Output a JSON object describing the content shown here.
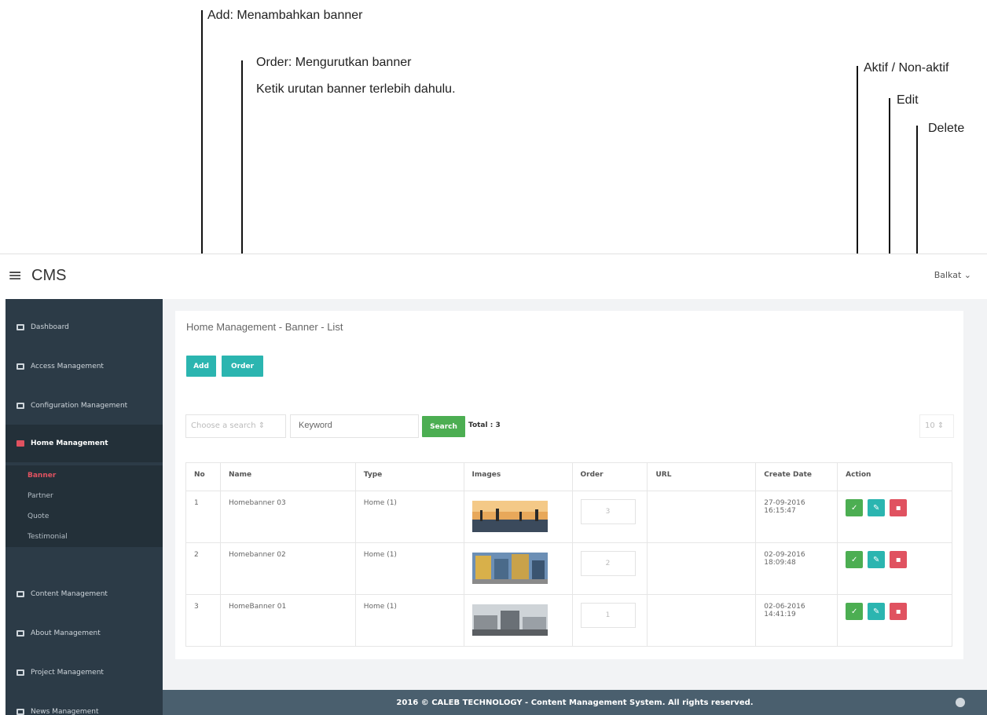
{
  "annotations": {
    "add": "Add: Menambahkan banner",
    "order_title": "Order: Mengurutkan banner",
    "order_desc": "Ketik urutan banner terlebih dahulu.",
    "aktif": "Aktif / Non-aktif",
    "edit": "Edit",
    "delete": "Delete"
  },
  "topbar": {
    "brand": "CMS",
    "user": "Balkat ⌄"
  },
  "sidebar": {
    "items": [
      {
        "label": "Dashboard"
      },
      {
        "label": "Access Management"
      },
      {
        "label": "Configuration Management"
      },
      {
        "label": "Home Management"
      },
      {
        "label": "Content Management"
      },
      {
        "label": "About Management"
      },
      {
        "label": "Project Management"
      },
      {
        "label": "News Management"
      }
    ],
    "sub_items": [
      {
        "label": "Banner"
      },
      {
        "label": "Partner"
      },
      {
        "label": "Quote"
      },
      {
        "label": "Testimonial"
      }
    ]
  },
  "page": {
    "breadcrumb": "Home Management - Banner - List",
    "add_label": "Add",
    "order_label": "Order",
    "search_select": "Choose a search ⇕",
    "keyword_placeholder": "Keyword",
    "search_label": "Search",
    "total": "Total : 3",
    "per_page": "10 ⇕"
  },
  "table": {
    "headers": [
      "No",
      "Name",
      "Type",
      "Images",
      "Order",
      "URL",
      "Create Date",
      "Action"
    ],
    "rows": [
      {
        "no": "1",
        "name": "Homebanner 03",
        "type": "Home (1)",
        "order": "3",
        "url": "",
        "date": "27-09-2016",
        "time": "16:15:47"
      },
      {
        "no": "2",
        "name": "Homebanner 02",
        "type": "Home (1)",
        "order": "2",
        "url": "",
        "date": "02-09-2016",
        "time": "18:09:48"
      },
      {
        "no": "3",
        "name": "HomeBanner 01",
        "type": "Home (1)",
        "order": "1",
        "url": "",
        "date": "02-06-2016",
        "time": "14:41:19"
      }
    ]
  },
  "footer": {
    "text": "2016 © CALEB TECHNOLOGY - Content Management System. All rights reserved."
  },
  "colors": {
    "teal": "#2bb5b0",
    "green": "#4cae52",
    "red": "#e05260",
    "sidebar": "#2c3b47",
    "footer": "#4a5f6e"
  }
}
